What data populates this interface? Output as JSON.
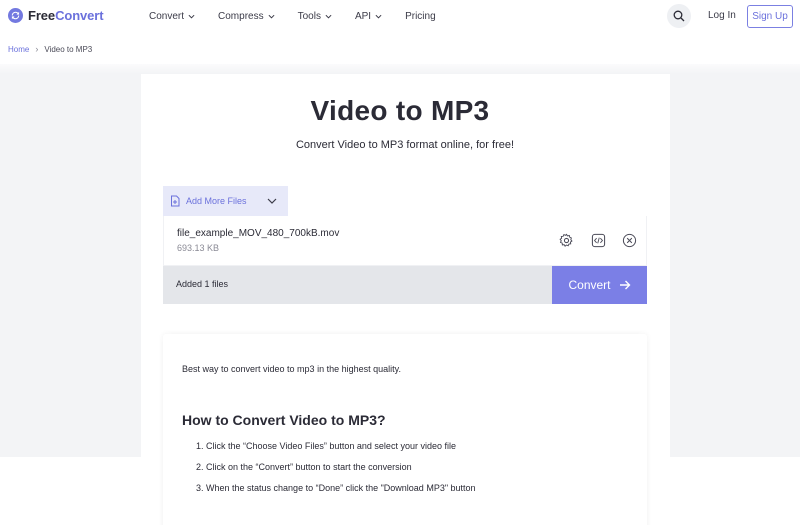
{
  "header": {
    "logo_primary": "Free",
    "logo_accent": "Convert",
    "nav": [
      {
        "label": "Convert"
      },
      {
        "label": "Compress"
      },
      {
        "label": "Tools"
      },
      {
        "label": "API"
      },
      {
        "label": "Pricing"
      }
    ],
    "login_label": "Log In",
    "signup_label": "Sign Up"
  },
  "breadcrumb": {
    "home": "Home",
    "current": "Video to MP3"
  },
  "page": {
    "title": "Video to MP3",
    "subtitle": "Convert Video to MP3 format online, for free!"
  },
  "uploader": {
    "add_files_label": "Add More Files",
    "file": {
      "name": "file_example_MOV_480_700kB.mov",
      "size": "693.13 KB"
    },
    "status_text": "Added 1 files",
    "convert_label": "Convert"
  },
  "info": {
    "intro": "Best way to convert video to mp3 in the highest quality.",
    "heading": "How to Convert Video to MP3?",
    "steps": [
      "1. Click the “Choose Video Files” button and select your video file",
      "2. Click on the “Convert” button to start the conversion",
      "3. When the status change to “Done” click the \"Download MP3\" button"
    ]
  },
  "colors": {
    "accent": "#6b71dc",
    "convert_button": "#7b7fe6",
    "add_files_bg": "#e7e9f9",
    "status_bg": "#e4e6ea"
  },
  "icons": {
    "logo": "refresh-circle-icon",
    "nav_dropdown": "chevron-down-icon",
    "search": "search-icon",
    "file": "file-plus-icon",
    "settings": "gear-icon",
    "embed": "code-icon",
    "remove": "close-circle-icon",
    "convert": "arrow-right-icon"
  }
}
